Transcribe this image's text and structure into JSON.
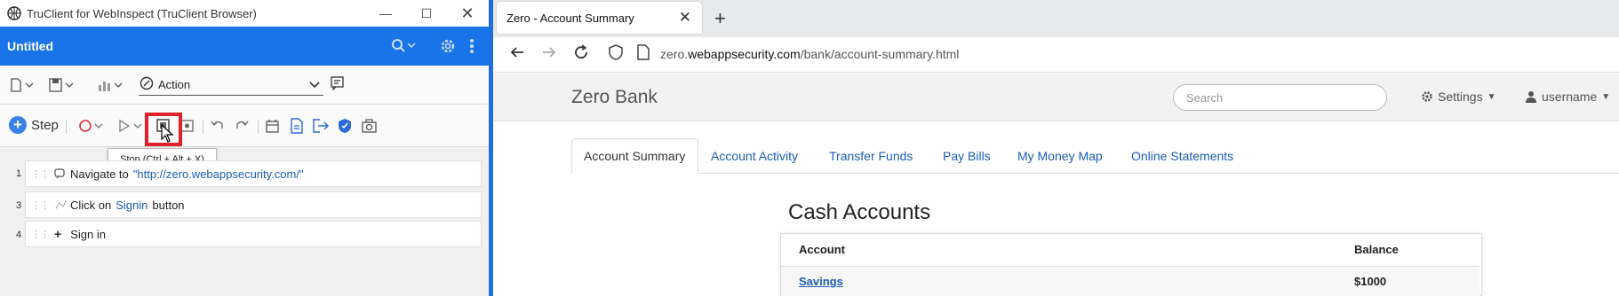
{
  "left_window": {
    "title": "TruClient for WebInspect (TruClient Browser)",
    "script_title": "Untitled",
    "action_select": "Action",
    "step_button": "Step",
    "tooltip": "Stop (Ctrl + Alt + X)",
    "steps": [
      {
        "num": "1",
        "verb": "Navigate to",
        "target": "\"http://zero.webappsecurity.com/\"",
        "tail": ""
      },
      {
        "num": "3",
        "verb": "Click on",
        "target": "Signin",
        "tail": "button"
      },
      {
        "num": "4",
        "verb": "",
        "target": "",
        "tail": "Sign in"
      }
    ],
    "colors": {
      "accent": "#1874e8",
      "highlight": "#e0202a"
    }
  },
  "browser": {
    "tab_title": "Zero - Account Summary",
    "url_prefix": "zero.",
    "url_domain": "webappsecurity.com",
    "url_path": "/bank/account-summary.html",
    "brand": "Zero Bank",
    "search_placeholder": "Search",
    "settings_label": "Settings",
    "user_label": "username",
    "nav_tabs": [
      "Account Summary",
      "Account Activity",
      "Transfer Funds",
      "Pay Bills",
      "My Money Map",
      "Online Statements"
    ],
    "section_title": "Cash Accounts",
    "table": {
      "headers": [
        "Account",
        "Balance"
      ],
      "rows": [
        {
          "account": "Savings",
          "balance": "$1000"
        }
      ]
    }
  }
}
